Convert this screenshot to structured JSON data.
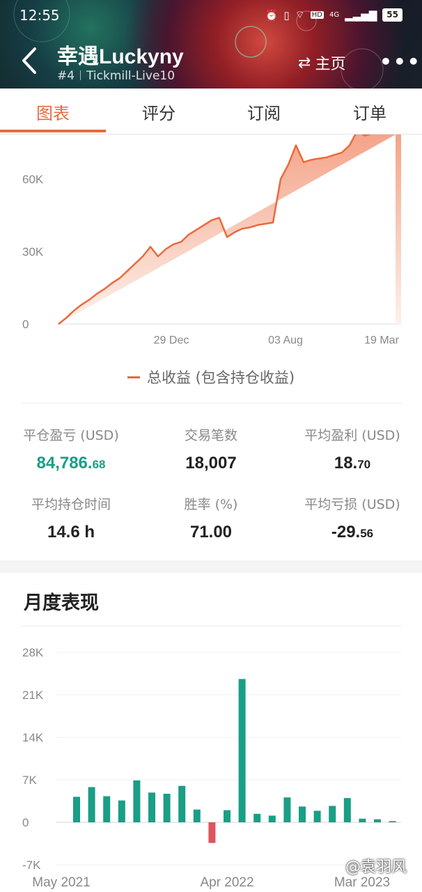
{
  "status_bar": {
    "time": "12:55",
    "network": "4G",
    "hd": "HD",
    "battery": "55"
  },
  "header": {
    "title": "幸遇Luckyny",
    "rank": "#4",
    "server": "Tickmill-Live10",
    "home_label": "主页"
  },
  "tabs": [
    "图表",
    "评分",
    "订阅",
    "订单"
  ],
  "colors": {
    "accent": "#e96a3d",
    "profit": "#1a9e86",
    "loss": "#e0535f"
  },
  "stats": [
    {
      "label": "平仓盈亏 (USD)",
      "value_main": "84,786.",
      "value_dec": "68"
    },
    {
      "label": "交易笔数",
      "value_main": "18,007",
      "value_dec": ""
    },
    {
      "label": "平均盈利 (USD)",
      "value_main": "18.",
      "value_dec": "70"
    },
    {
      "label": "平均持仓时间",
      "value_main": "14.6 h",
      "value_dec": ""
    },
    {
      "label": "胜率 (%)",
      "value_main": "71.00",
      "value_dec": ""
    },
    {
      "label": "平均亏损 (USD)",
      "value_main": "-29.",
      "value_dec": "56"
    }
  ],
  "section_title": "月度表现",
  "watermark": "@袁羽风",
  "chart_data": [
    {
      "type": "area",
      "legend": "总收益 (包含持仓收益)",
      "y_ticks": [
        "0",
        "30K",
        "60K"
      ],
      "x_ticks": [
        "29 Dec",
        "03 Aug",
        "19 Mar"
      ],
      "ylim": [
        0,
        90000
      ],
      "series": [
        {
          "name": "总收益 (包含持仓收益)",
          "values": [
            0,
            2500,
            5500,
            8000,
            10000,
            12500,
            14500,
            17000,
            19000,
            22000,
            25000,
            28000,
            32000,
            28000,
            31000,
            33000,
            34000,
            37000,
            39000,
            41000,
            43000,
            44000,
            36000,
            38000,
            39500,
            40000,
            41000,
            41500,
            42000,
            60000,
            66000,
            74000,
            67000,
            68000,
            68500,
            69000,
            70000,
            71000,
            74000,
            80000,
            78000,
            79000,
            80000,
            80500,
            81500
          ]
        }
      ]
    },
    {
      "type": "bar",
      "y_ticks": [
        "28K",
        "21K",
        "14K",
        "7K",
        "0",
        "-7K"
      ],
      "x_ticks": [
        "May 2021",
        "Apr 2022",
        "Mar 2023"
      ],
      "ylim": [
        -7000,
        28000
      ],
      "values": [
        4200,
        5800,
        4300,
        3600,
        6900,
        4900,
        4700,
        6000,
        2100,
        -3400,
        2000,
        23600,
        1400,
        1100,
        4100,
        2600,
        1900,
        2700,
        4000,
        600,
        500,
        200
      ]
    }
  ]
}
